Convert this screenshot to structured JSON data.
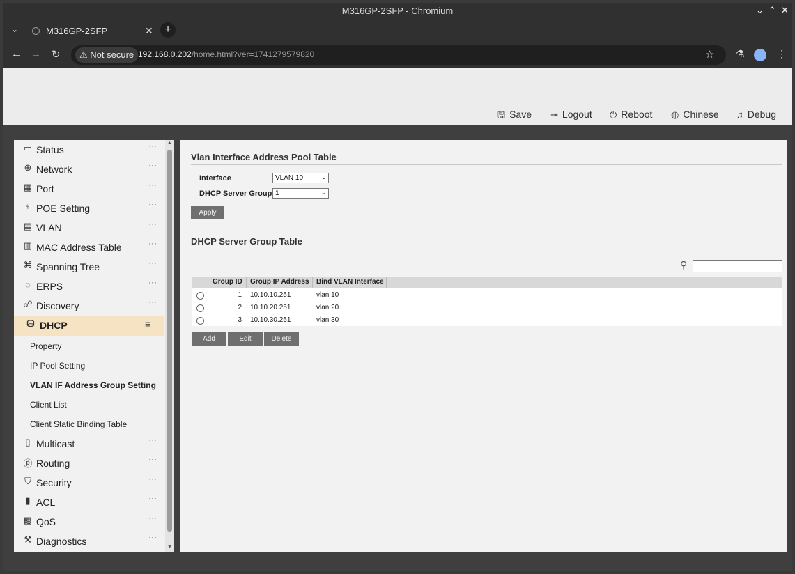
{
  "window": {
    "title": "M316GP-2SFP - Chromium"
  },
  "browser": {
    "tab_title": "M316GP-2SFP",
    "security_label": "Not secure",
    "url_host": "192.168.0.202",
    "url_path": "/home.html?ver=1741279579820"
  },
  "header": {
    "buttons": [
      {
        "label": "Save",
        "icon": "save-icon"
      },
      {
        "label": "Logout",
        "icon": "logout-icon"
      },
      {
        "label": "Reboot",
        "icon": "power-icon"
      },
      {
        "label": "Chinese",
        "icon": "globe-icon"
      },
      {
        "label": "Debug",
        "icon": "bell-icon"
      }
    ]
  },
  "sidebar": {
    "items": [
      {
        "label": "Status",
        "icon": "monitor-icon"
      },
      {
        "label": "Network",
        "icon": "globe-icon"
      },
      {
        "label": "Port",
        "icon": "port-icon"
      },
      {
        "label": "POE Setting",
        "icon": "plug-icon"
      },
      {
        "label": "VLAN",
        "icon": "vlan-icon"
      },
      {
        "label": "MAC Address Table",
        "icon": "table-icon"
      },
      {
        "label": "Spanning Tree",
        "icon": "tree-icon"
      },
      {
        "label": "ERPS",
        "icon": "ring-icon"
      },
      {
        "label": "Discovery",
        "icon": "topology-icon"
      },
      {
        "label": "DHCP",
        "icon": "database-icon"
      },
      {
        "label": "Multicast",
        "icon": "multicast-icon"
      },
      {
        "label": "Routing",
        "icon": "routing-icon"
      },
      {
        "label": "Security",
        "icon": "shield-icon"
      },
      {
        "label": "ACL",
        "icon": "acl-icon"
      },
      {
        "label": "QoS",
        "icon": "qos-icon"
      },
      {
        "label": "Diagnostics",
        "icon": "wrench-icon"
      }
    ],
    "active": "DHCP",
    "dhcp_sub": [
      {
        "label": "Property"
      },
      {
        "label": "IP Pool Setting"
      },
      {
        "label": "VLAN IF Address Group Setting"
      },
      {
        "label": "Client List"
      },
      {
        "label": "Client Static Binding Table"
      }
    ],
    "current_sub": "VLAN IF Address Group Setting"
  },
  "pool_section": {
    "title": "Vlan Interface Address Pool Table",
    "interface_label": "Interface",
    "interface_value": "VLAN 10",
    "group_label": "DHCP Server Group",
    "group_value": "1",
    "apply_label": "Apply"
  },
  "group_section": {
    "title": "DHCP Server Group Table",
    "search_value": "",
    "columns": [
      "Group ID",
      "Group IP Address",
      "Bind VLAN Interface"
    ],
    "rows": [
      {
        "id": "1",
        "ip": "10.10.10.251",
        "vlan": "vlan 10"
      },
      {
        "id": "2",
        "ip": "10.10.20.251",
        "vlan": "vlan 20"
      },
      {
        "id": "3",
        "ip": "10.10.30.251",
        "vlan": "vlan 30"
      }
    ],
    "add_label": "Add",
    "edit_label": "Edit",
    "delete_label": "Delete"
  },
  "colors": {
    "active_item_bg": "#f6e3c4",
    "button_gray": "#6f6f6f",
    "browser_dark": "#303030"
  }
}
